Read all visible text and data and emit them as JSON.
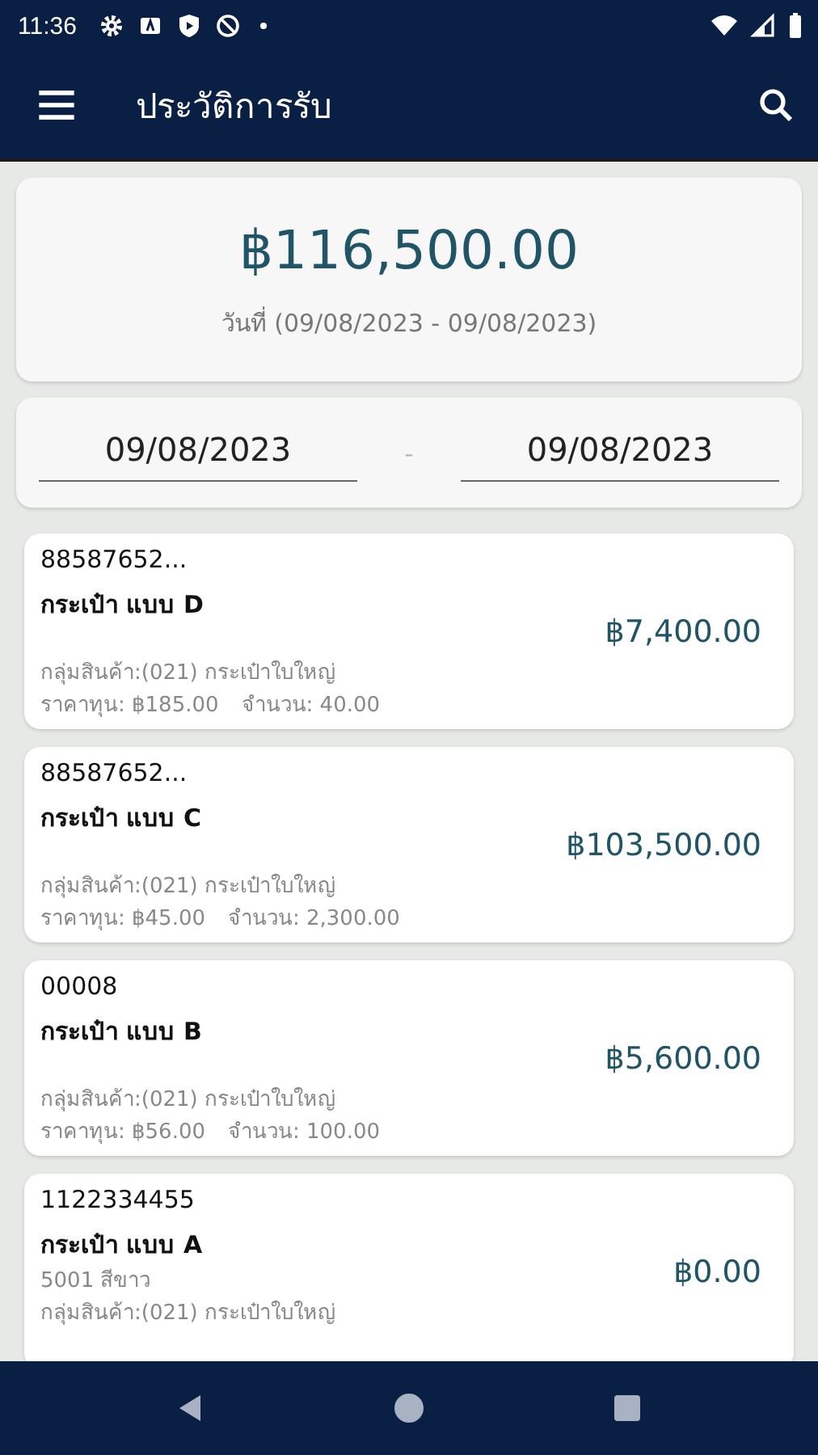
{
  "status_bar": {
    "time": "11:36"
  },
  "app_bar": {
    "title": "ประวัติการรับ"
  },
  "summary": {
    "total": "฿116,500.00",
    "date_range": "วันที่ (09/08/2023 - 09/08/2023)"
  },
  "date_filter": {
    "from": "09/08/2023",
    "separator": "-",
    "to": "09/08/2023"
  },
  "items": [
    {
      "code": "88587652...",
      "name": "กระเป๋า แบบ D",
      "group": "กลุ่มสินค้า:(021) กระเป๋าใบใหญ่",
      "cost": "ราคาทุน: ฿185.00",
      "quantity": "จำนวน: 40.00",
      "amount": "฿7,400.00"
    },
    {
      "code": "88587652...",
      "name": "กระเป๋า แบบ C",
      "group": "กลุ่มสินค้า:(021) กระเป๋าใบใหญ่",
      "cost": "ราคาทุน: ฿45.00",
      "quantity": "จำนวน: 2,300.00",
      "amount": "฿103,500.00"
    },
    {
      "code": "00008",
      "name": "กระเป๋า แบบ B",
      "group": "กลุ่มสินค้า:(021) กระเป๋าใบใหญ่",
      "cost": "ราคาทุน: ฿56.00",
      "quantity": "จำนวน: 100.00",
      "amount": "฿5,600.00"
    },
    {
      "code": "1122334455",
      "name": "กระเป๋า แบบ A",
      "variant": "5001 สีขาว",
      "group": "กลุ่มสินค้า:(021) กระเป๋าใบใหญ่",
      "amount": "฿0.00"
    }
  ]
}
